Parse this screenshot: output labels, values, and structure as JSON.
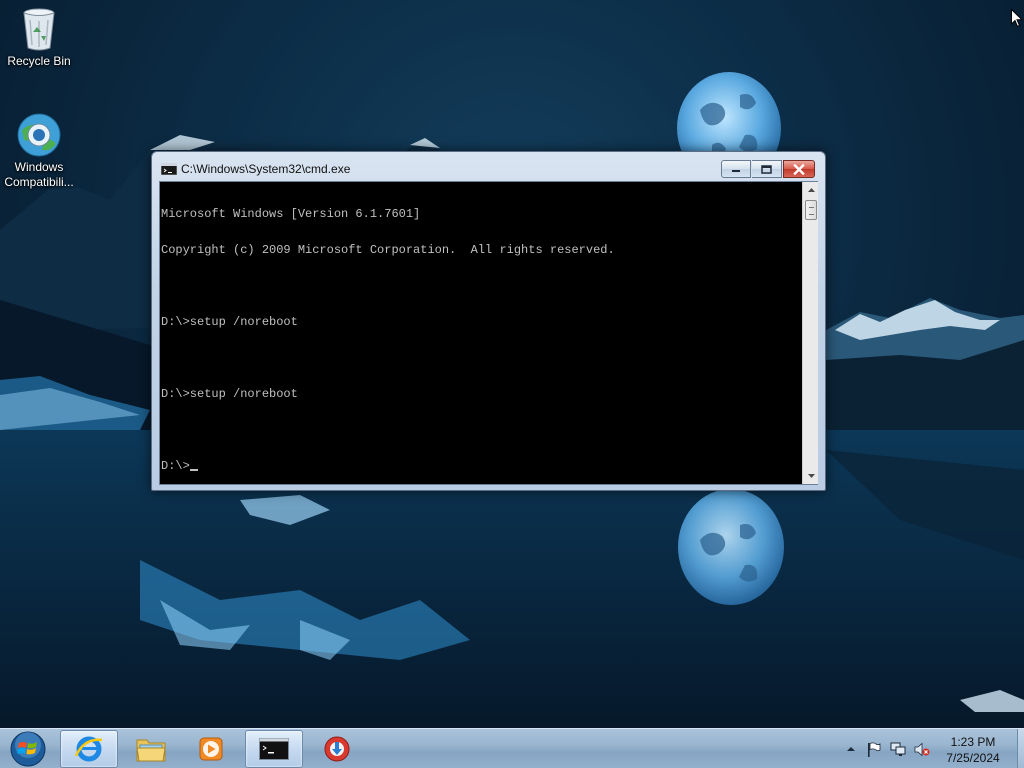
{
  "desktop": {
    "icons": [
      {
        "label": "Recycle Bin",
        "icon": "recycle-bin-icon"
      },
      {
        "label": "Windows Compatibili...",
        "icon": "compatibility-globe-icon"
      }
    ]
  },
  "cmd_window": {
    "title": "C:\\Windows\\System32\\cmd.exe",
    "console_lines": [
      "Microsoft Windows [Version 6.1.7601]",
      "Copyright (c) 2009 Microsoft Corporation.  All rights reserved.",
      "",
      "D:\\>setup /noreboot",
      "",
      "D:\\>setup /noreboot",
      "",
      "D:\\>"
    ],
    "console_colors": {
      "background": "#000000",
      "foreground": "#c0c0c0"
    }
  },
  "taskbar": {
    "pinned": [
      {
        "name": "Internet Explorer",
        "icon": "internet-explorer-icon",
        "active": true
      },
      {
        "name": "Windows Explorer",
        "icon": "folder-icon",
        "active": false
      },
      {
        "name": "Windows Media Player",
        "icon": "media-player-icon",
        "active": false
      },
      {
        "name": "Command Prompt",
        "icon": "cmd-icon",
        "active": true
      },
      {
        "name": "Installer",
        "icon": "installer-icon",
        "active": false
      }
    ],
    "tray_icons": [
      "show-hidden-icons-icon",
      "action-center-flag-icon",
      "network-icon",
      "volume-muted-icon"
    ]
  },
  "clock": {
    "time": "1:23 PM",
    "date": "7/25/2024"
  },
  "colors": {
    "taskbar": "#93b0cc",
    "close_button": "#c0392b",
    "window_frame": "#c2d3e7"
  }
}
